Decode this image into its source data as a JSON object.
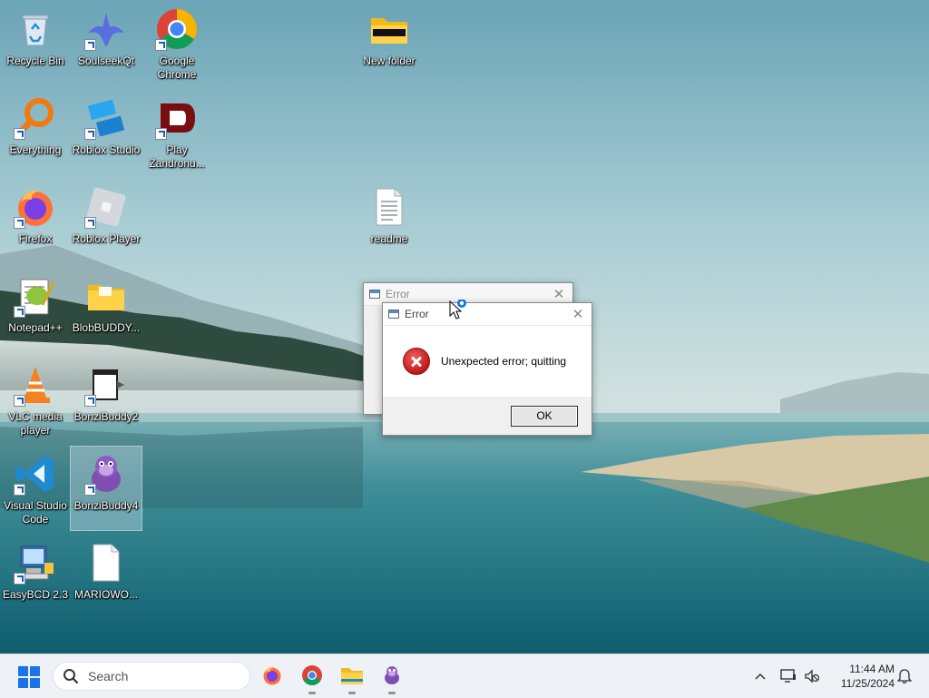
{
  "desktop": {
    "icons": [
      {
        "label": "Recycle Bin",
        "icon": "recycle-bin-icon"
      },
      {
        "label": "SoulseekQt",
        "icon": "soulseek-icon"
      },
      {
        "label": "Google Chrome",
        "icon": "chrome-icon"
      },
      {
        "label": "New folder",
        "icon": "folder-icon"
      },
      {
        "label": "Everything",
        "icon": "everything-search-icon"
      },
      {
        "label": "Roblox Studio",
        "icon": "roblox-studio-icon"
      },
      {
        "label": "Play Zandronu...",
        "icon": "zandronum-icon"
      },
      {
        "label": "Firefox",
        "icon": "firefox-icon"
      },
      {
        "label": "Roblox Player",
        "icon": "roblox-player-icon"
      },
      {
        "label": "readme",
        "icon": "text-document-icon"
      },
      {
        "label": "Notepad++",
        "icon": "notepad-plus-plus-icon"
      },
      {
        "label": "BlobBUDDY...",
        "icon": "folder-icon"
      },
      {
        "label": "VLC media player",
        "icon": "vlc-icon"
      },
      {
        "label": "BonziBuddy2",
        "icon": "bonzibuddy2-icon"
      },
      {
        "label": "Visual Studio Code",
        "icon": "vscode-icon"
      },
      {
        "label": "BonziBuddy4",
        "icon": "bonzibuddy-icon"
      },
      {
        "label": "EasyBCD 2.3",
        "icon": "easybcd-icon"
      },
      {
        "label": "MARIOWO...",
        "icon": "blank-file-icon"
      }
    ]
  },
  "dialogs": {
    "back": {
      "title": "Error"
    },
    "front": {
      "title": "Error",
      "message": "Unexpected error; quitting",
      "ok_label": "OK",
      "icon": "error-icon"
    }
  },
  "taskbar": {
    "search_placeholder": "Search",
    "pinned": [
      "firefox-icon",
      "chrome-icon",
      "file-explorer-icon",
      "bonzibuddy-icon"
    ],
    "clock_time": "11:44 AM",
    "clock_date": "11/25/2024"
  },
  "colors": {
    "taskbar_bg": "#eef1f6",
    "dialog_bg": "#f0f0f0",
    "error_red": "#c01818",
    "windows_blue": "#1a73e8"
  }
}
